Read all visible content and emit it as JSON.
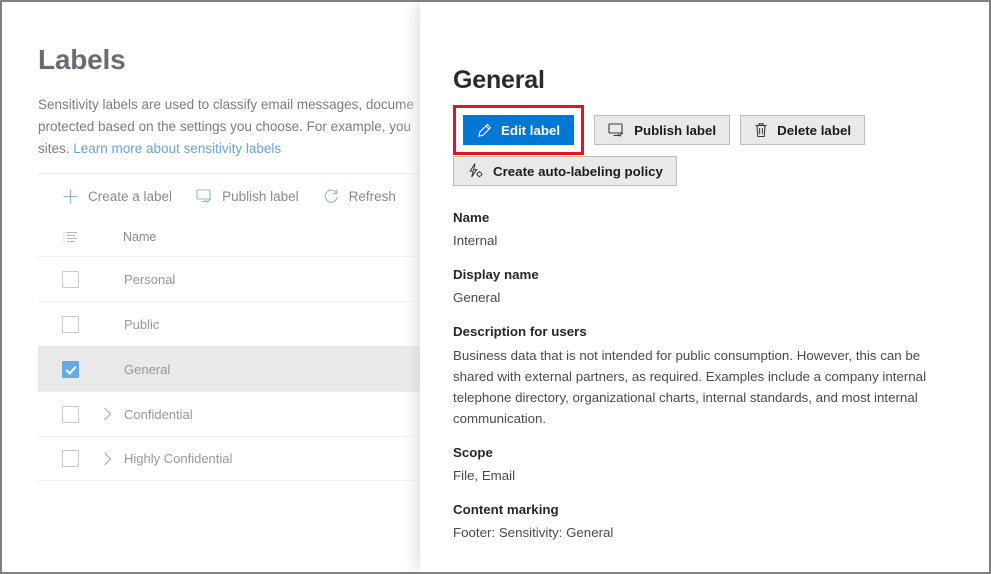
{
  "background_page": {
    "title": "Labels",
    "description": "Sensitivity labels are used to classify email messages, docume\nprotected based on the settings you choose. For example, you\nsites. ",
    "description_link": "Learn more about sensitivity labels",
    "command_bar": [
      {
        "label": "Create a label",
        "icon": "plus-icon"
      },
      {
        "label": "Publish label",
        "icon": "publish-monitor-icon"
      },
      {
        "label": "Refresh",
        "icon": "refresh-icon"
      }
    ],
    "table": {
      "column_header_icon": "list-order-icon",
      "columns": [
        "Name"
      ],
      "rows": [
        {
          "name": "Personal",
          "checked": false,
          "expandable": false,
          "selected": false
        },
        {
          "name": "Public",
          "checked": false,
          "expandable": false,
          "selected": false
        },
        {
          "name": "General",
          "checked": true,
          "expandable": false,
          "selected": true
        },
        {
          "name": "Confidential",
          "checked": false,
          "expandable": true,
          "selected": false
        },
        {
          "name": "Highly Confidential",
          "checked": false,
          "expandable": true,
          "selected": false
        }
      ],
      "row_menu_icon": "more-vertical-icon"
    }
  },
  "panel": {
    "title": "General",
    "buttons": [
      {
        "label": "Edit label",
        "icon": "pencil-icon",
        "primary": true,
        "highlighted": true
      },
      {
        "label": "Publish label",
        "icon": "publish-monitor-icon",
        "primary": false,
        "highlighted": false
      },
      {
        "label": "Delete label",
        "icon": "trash-icon",
        "primary": false,
        "highlighted": false
      },
      {
        "label": "Create auto-labeling policy",
        "icon": "auto-label-bolt-gear-icon",
        "primary": false,
        "highlighted": false
      }
    ],
    "fields": [
      {
        "label": "Name",
        "value": "Internal"
      },
      {
        "label": "Display name",
        "value": "General"
      },
      {
        "label": "Description for users",
        "value": "Business data that is not intended for public consumption. However, this can be shared with external partners, as required. Examples include a company internal telephone directory, organizational charts, internal standards, and most internal communication."
      },
      {
        "label": "Scope",
        "value": "File, Email"
      },
      {
        "label": "Content marking",
        "value": "Footer: Sensitivity: General"
      }
    ]
  },
  "colors": {
    "accent_blue": "#0078d4",
    "highlight_red": "#e81123",
    "checkbox_blue": "#63abe2",
    "link_blue": "#6ba3d6",
    "selected_row": "#e9e9e9"
  }
}
